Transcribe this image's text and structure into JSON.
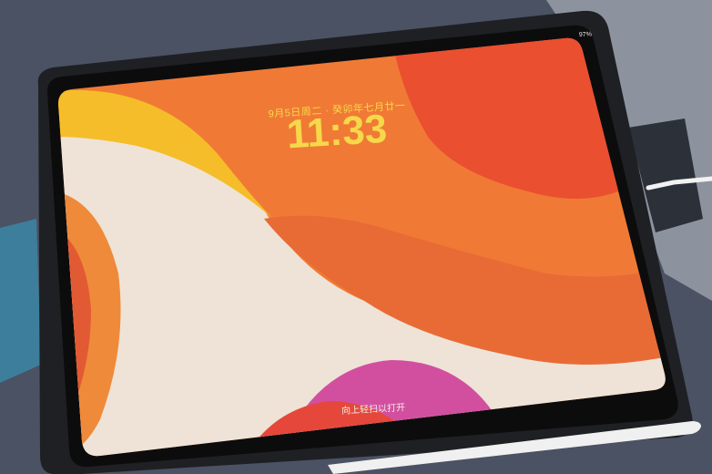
{
  "lockscreen": {
    "date_line": "9月5日周二 · 癸卯年七月廿一",
    "time": "11:33",
    "swipe_hint": "向上轻扫以打开",
    "status_text": "97%"
  },
  "colors": {
    "time_text": "#f6d84a",
    "wallpaper_orange": "#f07a35",
    "wallpaper_red": "#e5483a",
    "wallpaper_cream": "#eee3d6",
    "wallpaper_yellow": "#f5bd2a",
    "wallpaper_pink": "#d24fa0",
    "bezel": "#151515",
    "case": "#222428"
  }
}
